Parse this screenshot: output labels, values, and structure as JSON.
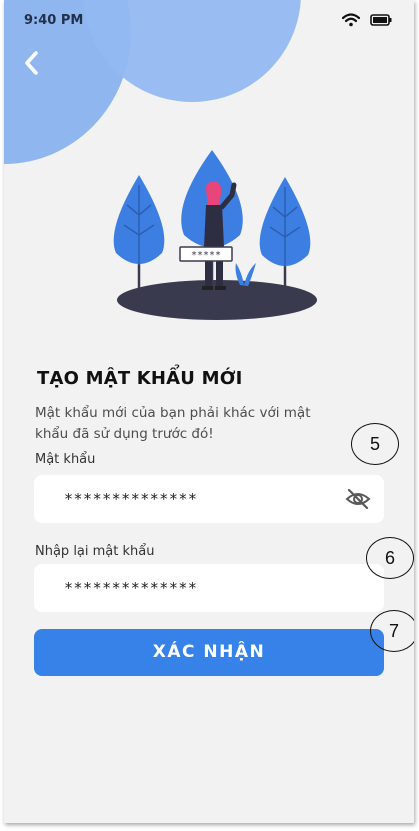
{
  "status": {
    "time": "9:40 PM"
  },
  "illustration": {
    "password_mask": "*****"
  },
  "title": "TẠO MẬT KHẨU MỚI",
  "description": "Mật khẩu mới của bạn phải khác với mật khẩu đã sử dụng trước đó!",
  "password": {
    "label": "Mật khẩu",
    "value": "**************"
  },
  "confirm_password": {
    "label": "Nhập lại mật khẩu",
    "value": "**************"
  },
  "submit_label": "XÁC NHẬN",
  "annotations": [
    "5",
    "6",
    "7"
  ],
  "colors": {
    "accent": "#3782e8",
    "circle": "#8ab2ee",
    "background": "#f2f2f2",
    "tree": "#3d7ee3"
  },
  "icons": [
    "wifi-icon",
    "battery-icon",
    "back-arrow-icon",
    "eye-off-icon"
  ]
}
